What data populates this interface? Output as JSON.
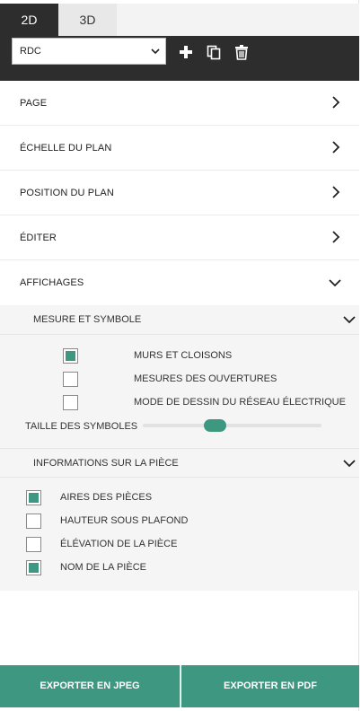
{
  "view_tabs": [
    {
      "label": "2D",
      "active": true
    },
    {
      "label": "3D",
      "active": false
    }
  ],
  "toolbar": {
    "level_select": {
      "value": "RDC"
    },
    "icons": [
      "plus-icon",
      "copy-icon",
      "trash-icon"
    ]
  },
  "panels": [
    {
      "label": "PAGE",
      "expanded": false
    },
    {
      "label": "ÉCHELLE DU PLAN",
      "expanded": false
    },
    {
      "label": "POSITION DU PLAN",
      "expanded": false
    },
    {
      "label": "ÉDITER",
      "expanded": false
    },
    {
      "label": "AFFICHAGES",
      "expanded": true
    }
  ],
  "mesure_section": {
    "title": "MESURE ET SYMBOLE",
    "options": [
      {
        "label": "MURS ET CLOISONS",
        "checked": true
      },
      {
        "label": "MESURES DES OUVERTURES",
        "checked": false
      },
      {
        "label": "MODE DE DESSIN DU RÉSEAU ÉLECTRIQUE",
        "checked": false
      }
    ],
    "slider": {
      "label": "TAILLE DES SYMBOLES",
      "value": 0.39
    }
  },
  "piece_section": {
    "title": "INFORMATIONS SUR LA PIÈCE",
    "options": [
      {
        "label": "AIRES DES PIÈCES",
        "checked": true
      },
      {
        "label": "HAUTEUR SOUS PLAFOND",
        "checked": false
      },
      {
        "label": "ÉLÉVATION DE LA PIÈCE",
        "checked": false
      },
      {
        "label": "NOM DE LA PIÈCE",
        "checked": true
      }
    ]
  },
  "export": {
    "jpeg_label": "EXPORTER EN JPEG",
    "pdf_label": "EXPORTER EN PDF"
  },
  "colors": {
    "accent": "#3e9780",
    "toolbar": "#2d2d2d"
  }
}
